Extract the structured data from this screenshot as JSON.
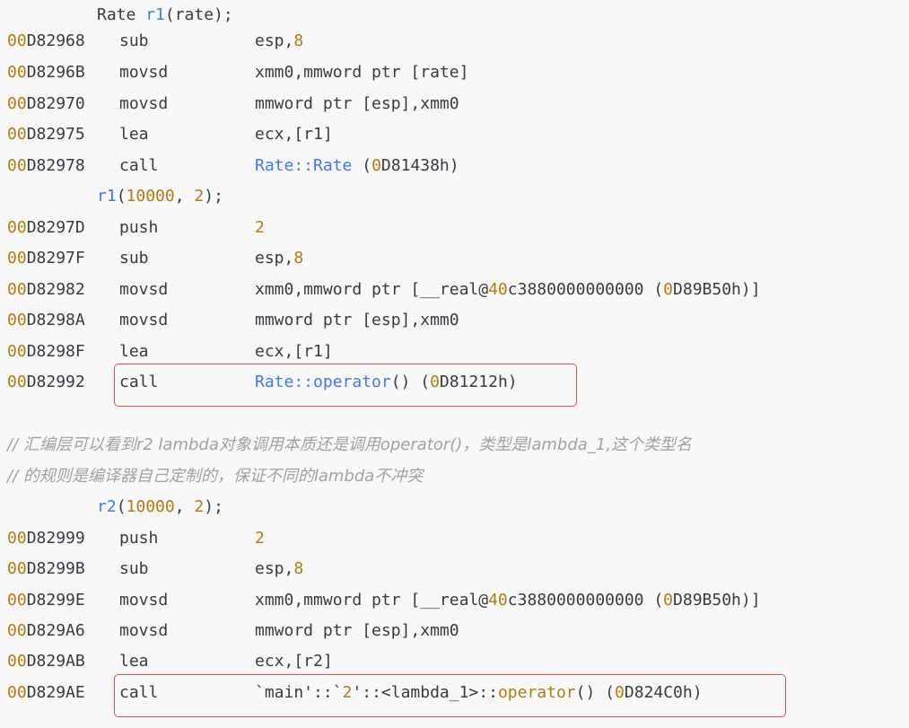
{
  "lines": [
    {
      "type": "src",
      "pre": "Rate ",
      "fn": "r1",
      "post": "(rate);"
    },
    {
      "type": "asm",
      "addr_hi": "00",
      "addr_lo": "D82968",
      "mnem": "sub",
      "op": [
        [
          "esp,",
          "p"
        ],
        [
          "8",
          "n"
        ]
      ]
    },
    {
      "type": "asm",
      "addr_hi": "00",
      "addr_lo": "D8296B",
      "mnem": "movsd",
      "op": [
        [
          "xmm0,mmword ptr [rate]",
          "p"
        ]
      ]
    },
    {
      "type": "asm",
      "addr_hi": "00",
      "addr_lo": "D82970",
      "mnem": "movsd",
      "op": [
        [
          "mmword ptr [esp],xmm0",
          "p"
        ]
      ]
    },
    {
      "type": "asm",
      "addr_hi": "00",
      "addr_lo": "D82975",
      "mnem": "lea",
      "op": [
        [
          "ecx,[r1]",
          "p"
        ]
      ]
    },
    {
      "type": "asm",
      "addr_hi": "00",
      "addr_lo": "D82978",
      "mnem": "call",
      "op": [
        [
          "Rate::Rate",
          "f"
        ],
        [
          " (",
          "p"
        ],
        [
          "0",
          "n"
        ],
        [
          "D81438h)",
          "p"
        ]
      ]
    },
    {
      "type": "src2",
      "fn": "r1",
      "args": [
        [
          "(",
          "p"
        ],
        [
          "10000",
          "n"
        ],
        [
          ", ",
          "p"
        ],
        [
          "2",
          "n"
        ],
        [
          ");",
          "p"
        ]
      ]
    },
    {
      "type": "asm",
      "addr_hi": "00",
      "addr_lo": "D8297D",
      "mnem": "push",
      "op": [
        [
          "2",
          "n"
        ]
      ]
    },
    {
      "type": "asm",
      "addr_hi": "00",
      "addr_lo": "D8297F",
      "mnem": "sub",
      "op": [
        [
          "esp,",
          "p"
        ],
        [
          "8",
          "n"
        ]
      ]
    },
    {
      "type": "asm",
      "addr_hi": "00",
      "addr_lo": "D82982",
      "mnem": "movsd",
      "op": [
        [
          "xmm0,mmword ptr [__real@",
          "p"
        ],
        [
          "40",
          "n"
        ],
        [
          "c3880000000000 (",
          "p"
        ],
        [
          "0",
          "n"
        ],
        [
          "D89B50h)]",
          "p"
        ]
      ]
    },
    {
      "type": "asm",
      "addr_hi": "00",
      "addr_lo": "D8298A",
      "mnem": "movsd",
      "op": [
        [
          "mmword ptr [esp],xmm0",
          "p"
        ]
      ]
    },
    {
      "type": "asm",
      "addr_hi": "00",
      "addr_lo": "D8298F",
      "mnem": "lea",
      "op": [
        [
          "ecx,[r1]",
          "p"
        ]
      ]
    },
    {
      "type": "asm",
      "addr_hi": "00",
      "addr_lo": "D82992",
      "mnem": "call",
      "op": [
        [
          "Rate::operator",
          "f"
        ],
        [
          "() (",
          "p"
        ],
        [
          "0",
          "n"
        ],
        [
          "D81212h)",
          "p"
        ]
      ],
      "box": 1
    },
    {
      "type": "blank"
    },
    {
      "type": "comment",
      "text": "// 汇编层可以看到r2 lambda对象调用本质还是调用operator()，类型是lambda_1,这个类型名"
    },
    {
      "type": "comment",
      "text": "// 的规则是编译器自己定制的，保证不同的lambda不冲突"
    },
    {
      "type": "src2",
      "fn": "r2",
      "args": [
        [
          "(",
          "p"
        ],
        [
          "10000",
          "n"
        ],
        [
          ", ",
          "p"
        ],
        [
          "2",
          "n"
        ],
        [
          ");",
          "p"
        ]
      ]
    },
    {
      "type": "asm",
      "addr_hi": "00",
      "addr_lo": "D82999",
      "mnem": "push",
      "op": [
        [
          "2",
          "n"
        ]
      ]
    },
    {
      "type": "asm",
      "addr_hi": "00",
      "addr_lo": "D8299B",
      "mnem": "sub",
      "op": [
        [
          "esp,",
          "p"
        ],
        [
          "8",
          "n"
        ]
      ]
    },
    {
      "type": "asm",
      "addr_hi": "00",
      "addr_lo": "D8299E",
      "mnem": "movsd",
      "op": [
        [
          "xmm0,mmword ptr [__real@",
          "p"
        ],
        [
          "40",
          "n"
        ],
        [
          "c3880000000000 (",
          "p"
        ],
        [
          "0",
          "n"
        ],
        [
          "D89B50h)]",
          "p"
        ]
      ]
    },
    {
      "type": "asm",
      "addr_hi": "00",
      "addr_lo": "D829A6",
      "mnem": "movsd",
      "op": [
        [
          "mmword ptr [esp],xmm0",
          "p"
        ]
      ]
    },
    {
      "type": "asm",
      "addr_hi": "00",
      "addr_lo": "D829AB",
      "mnem": "lea",
      "op": [
        [
          "ecx,[r2]",
          "p"
        ]
      ]
    },
    {
      "type": "asm",
      "addr_hi": "00",
      "addr_lo": "D829AE",
      "mnem": "call",
      "op": [
        [
          "`main'::`",
          "p"
        ],
        [
          "2",
          "n"
        ],
        [
          "'::<lambda_1>::",
          "p"
        ],
        [
          "operator",
          "n"
        ],
        [
          "() (",
          "p"
        ],
        [
          "0",
          "n"
        ],
        [
          "D824C0h)",
          "p"
        ]
      ],
      "box": 2
    }
  ],
  "colors": {
    "number": "#b07c10",
    "function": "#4078f2",
    "plain": "#383a42",
    "comment": "#a0a1a7",
    "highlight_box": "#e04b4b"
  }
}
